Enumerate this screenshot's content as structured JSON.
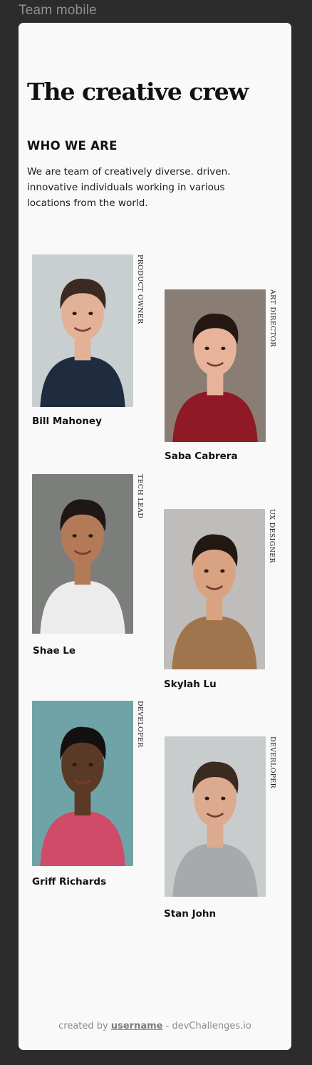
{
  "window": {
    "frame_label": "Team mobile"
  },
  "page": {
    "title": "The creative crew",
    "subtitle": "WHO WE ARE",
    "intro": "We are team of creatively diverse.  driven. innovative individuals working in various locations from the world."
  },
  "team": [
    {
      "name": "Bill Mahoney",
      "role": "PRODUCT OWNER",
      "bg": "#c9cfd0",
      "skin": "#e2b196",
      "hair": "#3a2a22",
      "shirt": "#1f2c3f"
    },
    {
      "name": "Saba Cabrera",
      "role": "ART DIRECTOR",
      "bg": "#8a7e74",
      "skin": "#e7b49b",
      "hair": "#251712",
      "shirt": "#8f1a26"
    },
    {
      "name": "Shae Le",
      "role": "TECH LEAD",
      "bg": "#7c7e7c",
      "skin": "#b47a58",
      "hair": "#1e1714",
      "shirt": "#ececec"
    },
    {
      "name": "Skylah Lu",
      "role": "UX DESIGNER",
      "bg": "#bfbdbc",
      "skin": "#d9a382",
      "hair": "#231712",
      "shirt": "#a0754d"
    },
    {
      "name": "Griff Richards",
      "role": "DEVELOPER",
      "bg": "#6fa3a8",
      "skin": "#5a3a26",
      "hair": "#141010",
      "shirt": "#cf4b68"
    },
    {
      "name": "Stan John",
      "role": "DEVERLOPER",
      "bg": "#c9cccd",
      "skin": "#dcab8f",
      "hair": "#3b2a1f",
      "shirt": "#a8a9ab"
    }
  ],
  "footer": {
    "prefix": "created by ",
    "username": "username",
    "suffix": " - devChallenges.io"
  }
}
